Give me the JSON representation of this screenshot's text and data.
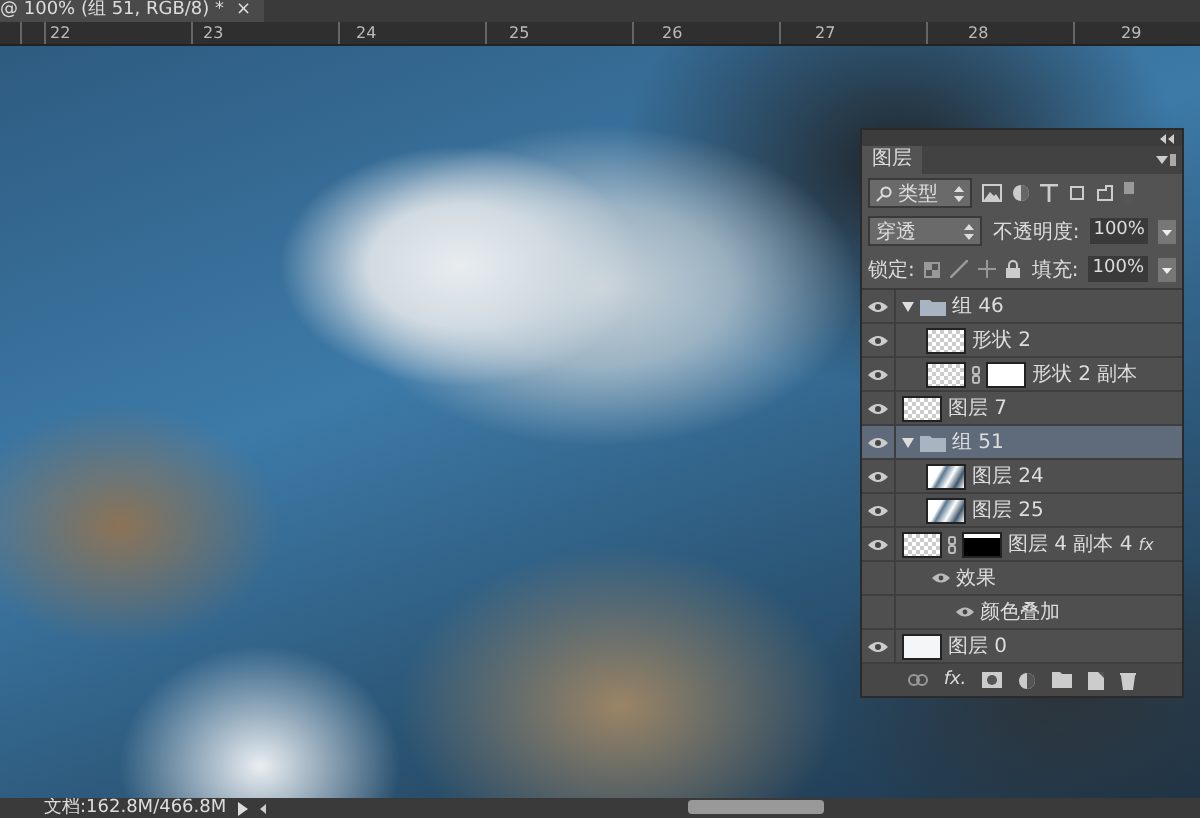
{
  "document_tab": {
    "title": "@ 100% (组 51, RGB/8) *",
    "close": "×"
  },
  "ruler": {
    "marks": [
      "22",
      "23",
      "24",
      "25",
      "26",
      "27",
      "28",
      "29"
    ]
  },
  "layers_panel": {
    "tab": "图层",
    "filter": {
      "value": "类型"
    },
    "blend_mode": {
      "value": "穿透"
    },
    "opacity": {
      "label": "不透明度:",
      "value": "100%"
    },
    "lock": {
      "label": "锁定:"
    },
    "fill": {
      "label": "填充:",
      "value": "100%"
    },
    "layers": [
      {
        "kind": "group",
        "name": "组 46",
        "visible": true,
        "expanded": true,
        "selected": false,
        "children": [
          {
            "kind": "layer",
            "name": "形状 2",
            "visible": true,
            "selected": false,
            "thumb": {
              "kind": "checker"
            }
          },
          {
            "kind": "layer",
            "name": "形状 2 副本",
            "visible": true,
            "selected": false,
            "thumb": {
              "kind": "checker"
            },
            "mask": {
              "kind": "white"
            }
          }
        ]
      },
      {
        "kind": "layer",
        "name": "图层 7",
        "visible": true,
        "selected": false,
        "thumb": {
          "kind": "checker"
        }
      },
      {
        "kind": "group",
        "name": "组 51",
        "visible": true,
        "expanded": true,
        "selected": true,
        "children": [
          {
            "kind": "layer",
            "name": "图层 24",
            "visible": true,
            "selected": false,
            "thumb": {
              "kind": "texture"
            }
          },
          {
            "kind": "layer",
            "name": "图层 25",
            "visible": true,
            "selected": false,
            "thumb": {
              "kind": "texture"
            }
          }
        ]
      },
      {
        "kind": "layer",
        "name": "图层 4 副本 4",
        "visible": true,
        "selected": false,
        "thumb": {
          "kind": "checker"
        },
        "mask": {
          "kind": "dark"
        },
        "fx": "fx",
        "effects": {
          "label": "效果",
          "items": [
            "颜色叠加"
          ]
        }
      },
      {
        "kind": "layer",
        "name": "图层 0",
        "visible": true,
        "selected": false,
        "thumb": {
          "kind": "white"
        }
      }
    ],
    "footer_fx": "fx."
  },
  "status_bar": {
    "doc_size": "文档:162.8M/466.8M"
  }
}
